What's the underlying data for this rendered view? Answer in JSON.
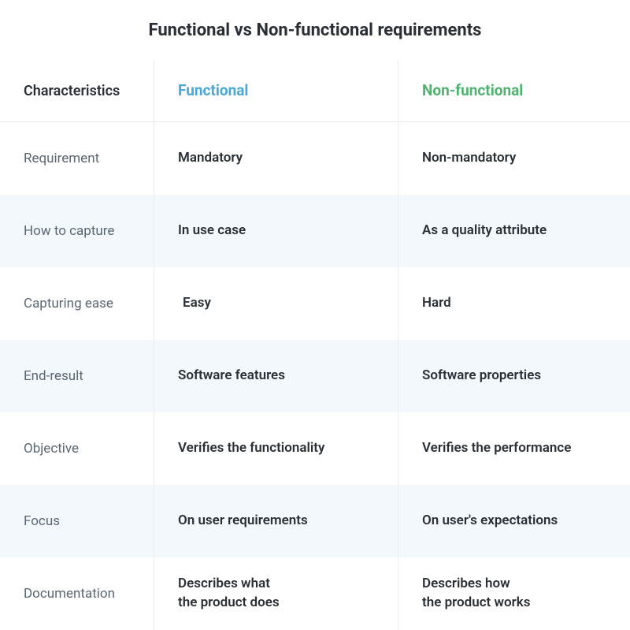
{
  "title": "Functional vs Non-functional requirements",
  "headers": {
    "characteristics": "Characteristics",
    "functional": "Functional",
    "nonfunctional": "Non-functional"
  },
  "rows": [
    {
      "characteristic": "Requirement",
      "functional": "Mandatory",
      "nonfunctional": "Non-mandatory"
    },
    {
      "characteristic": "How to capture",
      "functional": "In use case",
      "nonfunctional": "As a quality attribute"
    },
    {
      "characteristic": "Capturing ease",
      "functional": "Easy",
      "nonfunctional": "Hard"
    },
    {
      "characteristic": "End-result",
      "functional": "Software features",
      "nonfunctional": "Software properties"
    },
    {
      "characteristic": "Objective",
      "functional": "Verifies the functionality",
      "nonfunctional": "Verifies the performance"
    },
    {
      "characteristic": "Focus",
      "functional": "On user requirements",
      "nonfunctional": "On user's expectations"
    },
    {
      "characteristic": "Documentation",
      "functional": "Describes what\nthe product does",
      "nonfunctional": "Describes how\nthe product works"
    }
  ]
}
